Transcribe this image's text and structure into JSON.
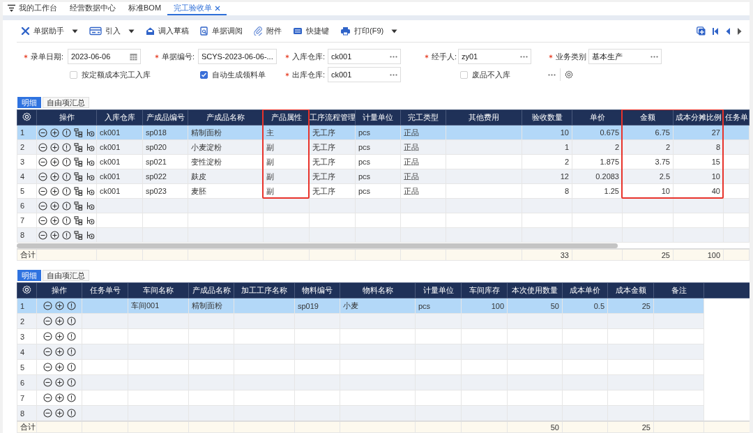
{
  "page_tabs": [
    {
      "label": "我的工作台",
      "selected": false,
      "menu": true
    },
    {
      "label": "经营数据中心",
      "selected": false
    },
    {
      "label": "标准BOM",
      "selected": false
    },
    {
      "label": "完工验收单",
      "selected": true,
      "closable": true
    }
  ],
  "toolbar": {
    "items": [
      {
        "label": "单据助手",
        "kind": "tools",
        "dropdown": true
      },
      {
        "label": "引入",
        "kind": "import",
        "dropdown": true
      },
      {
        "label": "调入草稿",
        "kind": "draft",
        "dropdown": false
      },
      {
        "label": "单据调阅",
        "kind": "review",
        "dropdown": false
      },
      {
        "label": "附件",
        "kind": "attach",
        "dropdown": false
      },
      {
        "label": "快捷键",
        "kind": "keys",
        "dropdown": false
      },
      {
        "label": "打印(F9)",
        "kind": "print",
        "dropdown": true
      }
    ],
    "nav": [
      {
        "kind": "copy",
        "disabled": false
      },
      {
        "kind": "first",
        "disabled": false
      },
      {
        "kind": "prev",
        "disabled": false
      },
      {
        "kind": "next",
        "disabled": true
      }
    ]
  },
  "form": {
    "rows": [
      [
        {
          "kind": "field",
          "label": "录单日期:",
          "required": true,
          "value": "2023-06-06",
          "calendar": true
        },
        {
          "kind": "field",
          "label": "单据编号:",
          "required": true,
          "value": "SCYS-2023-06-06-..."
        },
        {
          "kind": "field",
          "label": "入库仓库:",
          "required": true,
          "value": "ck001",
          "lookup": true
        },
        {
          "kind": "field",
          "label": "经手人:",
          "required": true,
          "value": "zy01",
          "lookup": true
        },
        {
          "kind": "field",
          "label": "业务类别",
          "required": true,
          "value": "基本生产",
          "lookup": true
        }
      ],
      [
        {
          "kind": "checkbox",
          "label": "按定额成本完工入库",
          "checked": false
        },
        {
          "kind": "checkbox",
          "label": "自动生成领料单",
          "checked": true
        },
        {
          "kind": "field",
          "label": "出库仓库:",
          "required": true,
          "value": "ck001",
          "lookup": true
        },
        {
          "kind": "checkbox",
          "label": "废品不入库",
          "checked": false
        },
        {
          "kind": "tools"
        }
      ]
    ]
  },
  "tables": [
    {
      "tabs": [
        {
          "label": "明细",
          "selected": true
        },
        {
          "label": "自由项汇总",
          "selected": false
        }
      ],
      "actions_header": "操作",
      "action_icons": [
        {
          "kind": "remove"
        },
        {
          "kind": "add"
        },
        {
          "kind": "info"
        },
        {
          "kind": "structure"
        },
        {
          "kind": "branch"
        }
      ],
      "horizontal_scroll": true,
      "columns": [
        {
          "label": "入库仓库",
          "kind": "text"
        },
        {
          "label": "产成品编号",
          "kind": "text"
        },
        {
          "label": "产成品名称",
          "kind": "text"
        },
        {
          "label": "产品属性",
          "kind": "text",
          "highlighted": true
        },
        {
          "label": "工序流程管理",
          "kind": "text"
        },
        {
          "label": "计量单位",
          "kind": "text"
        },
        {
          "label": "完工类型",
          "kind": "text"
        },
        {
          "label": "其他费用",
          "kind": "number"
        },
        {
          "label": "验收数量",
          "kind": "number"
        },
        {
          "label": "单价",
          "kind": "number"
        },
        {
          "label": "金额",
          "kind": "number",
          "highlighted": true
        },
        {
          "label": "成本分摊比例",
          "kind": "number",
          "highlighted": true
        },
        {
          "label": "任务单",
          "kind": "text"
        }
      ],
      "rows": [
        {
          "no": "1",
          "selected": true,
          "cells": [
            {
              "text": "ck001"
            },
            {
              "text": "sp018"
            },
            {
              "text": "精制面粉"
            },
            {
              "text": "主"
            },
            {
              "text": "无工序"
            },
            {
              "text": "pcs"
            },
            {
              "text": "正品"
            },
            {},
            {
              "text": "10"
            },
            {
              "text": "0.675"
            },
            {
              "text": "6.75"
            },
            {
              "text": "27"
            }
          ]
        },
        {
          "no": "2",
          "selected": false,
          "cells": [
            {
              "text": "ck001"
            },
            {
              "text": "sp020"
            },
            {
              "text": "小麦淀粉"
            },
            {
              "text": "副"
            },
            {
              "text": "无工序"
            },
            {
              "text": "pcs"
            },
            {
              "text": "正品"
            },
            {},
            {
              "text": "1"
            },
            {
              "text": "2"
            },
            {
              "text": "2"
            },
            {
              "text": "8"
            }
          ]
        },
        {
          "no": "3",
          "selected": false,
          "cells": [
            {
              "text": "ck001"
            },
            {
              "text": "sp021"
            },
            {
              "text": "变性淀粉"
            },
            {
              "text": "副"
            },
            {
              "text": "无工序"
            },
            {
              "text": "pcs"
            },
            {
              "text": "正品"
            },
            {},
            {
              "text": "2"
            },
            {
              "text": "1.875"
            },
            {
              "text": "3.75"
            },
            {
              "text": "15"
            }
          ]
        },
        {
          "no": "4",
          "selected": false,
          "cells": [
            {
              "text": "ck001"
            },
            {
              "text": "sp022"
            },
            {
              "text": "麸皮"
            },
            {
              "text": "副"
            },
            {
              "text": "无工序"
            },
            {
              "text": "pcs"
            },
            {
              "text": "正品"
            },
            {},
            {
              "text": "12"
            },
            {
              "text": "0.2083"
            },
            {
              "text": "2.5"
            },
            {
              "text": "10"
            }
          ]
        },
        {
          "no": "5",
          "selected": false,
          "cells": [
            {
              "text": "ck001"
            },
            {
              "text": "sp023"
            },
            {
              "text": "麦胚"
            },
            {
              "text": "副"
            },
            {
              "text": "无工序"
            },
            {
              "text": "pcs"
            },
            {
              "text": "正品"
            },
            {},
            {
              "text": "8"
            },
            {
              "text": "1.25"
            },
            {
              "text": "10"
            },
            {
              "text": "40"
            }
          ]
        },
        {
          "no": "6",
          "selected": false
        },
        {
          "no": "7",
          "selected": false
        },
        {
          "no": "8",
          "selected": false
        }
      ],
      "totals": {
        "label": "合计",
        "cells": [
          {},
          {},
          {},
          {},
          {},
          {},
          {},
          {},
          {
            "text": "33"
          },
          {},
          {
            "text": "25"
          },
          {
            "text": "100"
          }
        ]
      }
    },
    {
      "tabs": [
        {
          "label": "明细",
          "selected": true
        },
        {
          "label": "自由项汇总",
          "selected": false
        }
      ],
      "actions_header": "操作",
      "action_icons": [
        {
          "kind": "remove"
        },
        {
          "kind": "add"
        },
        {
          "kind": "info"
        }
      ],
      "filler": true,
      "columns": [
        {
          "label": "任务单号",
          "kind": "text"
        },
        {
          "label": "车间名称",
          "kind": "text"
        },
        {
          "label": "产成品名称",
          "kind": "text"
        },
        {
          "label": "加工工序名称",
          "kind": "text"
        },
        {
          "label": "物料编号",
          "kind": "text"
        },
        {
          "label": "物料名称",
          "kind": "text"
        },
        {
          "label": "计量单位",
          "kind": "text"
        },
        {
          "label": "车间库存",
          "kind": "number"
        },
        {
          "label": "本次使用数量",
          "kind": "number"
        },
        {
          "label": "成本单价",
          "kind": "number"
        },
        {
          "label": "成本金额",
          "kind": "number"
        },
        {
          "label": "备注",
          "kind": "text"
        }
      ],
      "rows": [
        {
          "no": "1",
          "selected": true,
          "cells": [
            {},
            {
              "text": "车间001"
            },
            {
              "text": "精制面粉"
            },
            {},
            {
              "text": "sp019"
            },
            {
              "text": "小麦"
            },
            {
              "text": "pcs"
            },
            {
              "text": "100"
            },
            {
              "text": "50"
            },
            {
              "text": "0.5"
            },
            {
              "text": "25"
            }
          ]
        },
        {
          "no": "2",
          "selected": false
        },
        {
          "no": "3",
          "selected": false
        },
        {
          "no": "4",
          "selected": false
        },
        {
          "no": "5",
          "selected": false
        },
        {
          "no": "6",
          "selected": false
        },
        {
          "no": "7",
          "selected": false
        },
        {
          "no": "8",
          "selected": false
        }
      ],
      "totals": {
        "label": "合计",
        "cells": [
          {},
          {},
          {},
          {},
          {},
          {},
          {},
          {},
          {
            "text": "50"
          },
          {},
          {
            "text": "25"
          }
        ]
      }
    }
  ]
}
